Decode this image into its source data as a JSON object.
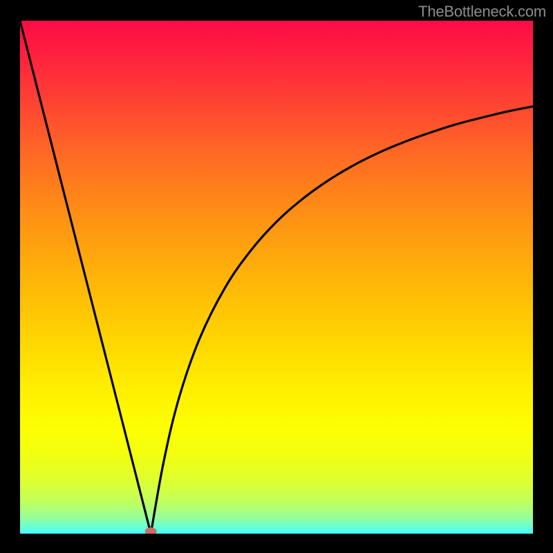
{
  "watermark": "TheBottleneck.com",
  "accent_colors": {
    "curve": "#000000",
    "marker": "#cf6b68"
  },
  "chart_data": {
    "type": "line",
    "title": "",
    "xlabel": "",
    "ylabel": "",
    "xlim": [
      0,
      100
    ],
    "ylim": [
      0,
      100
    ],
    "grid": false,
    "legend": false,
    "series": [
      {
        "name": "left-branch",
        "x": [
          0,
          5,
          10,
          15,
          20,
          25.5
        ],
        "values": [
          100,
          80.4,
          60.8,
          41.2,
          21.6,
          0
        ]
      },
      {
        "name": "right-branch",
        "x": [
          25.5,
          28,
          31,
          35,
          40,
          45,
          50,
          55,
          60,
          65,
          70,
          75,
          80,
          85,
          90,
          95,
          100
        ],
        "values": [
          0,
          14,
          26.5,
          38,
          48,
          55.2,
          60.8,
          65.2,
          68.8,
          71.8,
          74.3,
          76.4,
          78.2,
          79.8,
          81.1,
          82.3,
          83.3
        ]
      }
    ],
    "marker": {
      "x": 25.5,
      "y": 0,
      "color": "#cf6b68"
    }
  }
}
